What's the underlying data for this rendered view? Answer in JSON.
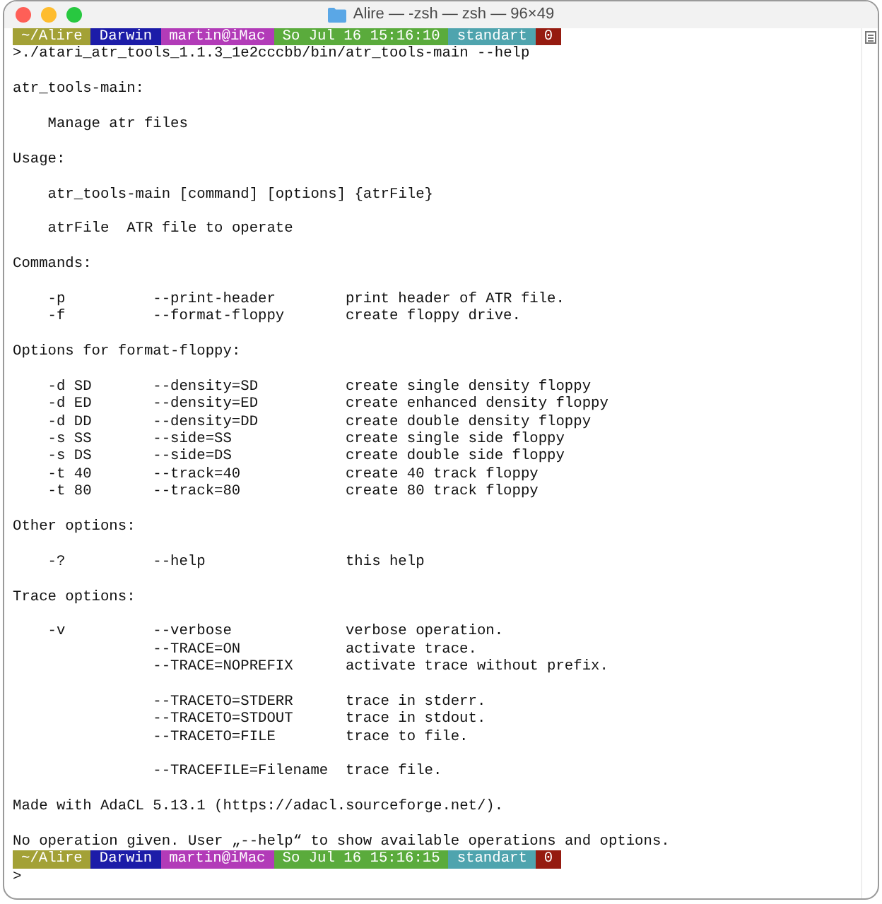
{
  "window": {
    "title": "Alire — -zsh — zsh — 96×49"
  },
  "lines": [
    {
      "kind": "prompt",
      "segments": [
        {
          "text": "~/Alire",
          "color": "#a3a136"
        },
        {
          "text": "Darwin",
          "color": "#1c1ca8"
        },
        {
          "text": "martin@iMac",
          "color": "#b23bb8"
        },
        {
          "text": "So Jul 16 15:16:10",
          "color": "#5aab3c"
        },
        {
          "text": "standart",
          "color": "#4fa4ae"
        },
        {
          "text": "0",
          "color": "#951b10"
        }
      ]
    },
    {
      "kind": "text",
      "text": ">./atari_atr_tools_1.1.3_1e2cccbb/bin/atr_tools-main --help"
    },
    {
      "kind": "blank"
    },
    {
      "kind": "text",
      "text": "atr_tools-main:"
    },
    {
      "kind": "blank"
    },
    {
      "kind": "text",
      "text": "    Manage atr files"
    },
    {
      "kind": "blank"
    },
    {
      "kind": "text",
      "text": "Usage:"
    },
    {
      "kind": "blank"
    },
    {
      "kind": "text",
      "text": "    atr_tools-main [command] [options] {atrFile}"
    },
    {
      "kind": "blank"
    },
    {
      "kind": "text",
      "text": "    atrFile  ATR file to operate"
    },
    {
      "kind": "blank"
    },
    {
      "kind": "text",
      "text": "Commands:"
    },
    {
      "kind": "blank"
    },
    {
      "kind": "option",
      "short": "-p",
      "long": "--print-header",
      "desc": "print header of ATR file."
    },
    {
      "kind": "option",
      "short": "-f",
      "long": "--format-floppy",
      "desc": "create floppy drive."
    },
    {
      "kind": "blank"
    },
    {
      "kind": "text",
      "text": "Options for format-floppy:"
    },
    {
      "kind": "blank"
    },
    {
      "kind": "option",
      "short": "-d SD",
      "long": "--density=SD",
      "desc": "create single density floppy"
    },
    {
      "kind": "option",
      "short": "-d ED",
      "long": "--density=ED",
      "desc": "create enhanced density floppy"
    },
    {
      "kind": "option",
      "short": "-d DD",
      "long": "--density=DD",
      "desc": "create double density floppy"
    },
    {
      "kind": "option",
      "short": "-s SS",
      "long": "--side=SS",
      "desc": "create single side floppy"
    },
    {
      "kind": "option",
      "short": "-s DS",
      "long": "--side=DS",
      "desc": "create double side floppy"
    },
    {
      "kind": "option",
      "short": "-t 40",
      "long": "--track=40",
      "desc": "create 40 track floppy"
    },
    {
      "kind": "option",
      "short": "-t 80",
      "long": "--track=80",
      "desc": "create 80 track floppy"
    },
    {
      "kind": "blank"
    },
    {
      "kind": "text",
      "text": "Other options:"
    },
    {
      "kind": "blank"
    },
    {
      "kind": "option",
      "short": "-?",
      "long": "--help",
      "desc": "this help"
    },
    {
      "kind": "blank"
    },
    {
      "kind": "text",
      "text": "Trace options:"
    },
    {
      "kind": "blank"
    },
    {
      "kind": "option",
      "short": "-v",
      "long": "--verbose",
      "desc": "verbose operation."
    },
    {
      "kind": "option",
      "long": "--TRACE=ON",
      "desc": "activate trace."
    },
    {
      "kind": "option",
      "long": "--TRACE=NOPREFIX",
      "desc": "activate trace without prefix."
    },
    {
      "kind": "blank"
    },
    {
      "kind": "option",
      "long": "--TRACETO=STDERR",
      "desc": "trace in stderr."
    },
    {
      "kind": "option",
      "long": "--TRACETO=STDOUT",
      "desc": "trace in stdout."
    },
    {
      "kind": "option",
      "long": "--TRACETO=FILE",
      "desc": "trace to file."
    },
    {
      "kind": "blank"
    },
    {
      "kind": "option",
      "long": "--TRACEFILE=Filename",
      "desc": "trace file."
    },
    {
      "kind": "blank"
    },
    {
      "kind": "text",
      "text": "Made with AdaCL 5.13.1 (https://adacl.sourceforge.net/)."
    },
    {
      "kind": "blank"
    },
    {
      "kind": "text",
      "text": "No operation given. User „--help“ to show available operations and options."
    },
    {
      "kind": "prompt",
      "segments": [
        {
          "text": "~/Alire",
          "color": "#a3a136"
        },
        {
          "text": "Darwin",
          "color": "#1c1ca8"
        },
        {
          "text": "martin@iMac",
          "color": "#b23bb8"
        },
        {
          "text": "So Jul 16 15:16:15",
          "color": "#5aab3c"
        },
        {
          "text": "standart",
          "color": "#4fa4ae"
        },
        {
          "text": "0",
          "color": "#951b10"
        }
      ]
    },
    {
      "kind": "text",
      "text": ">"
    }
  ]
}
